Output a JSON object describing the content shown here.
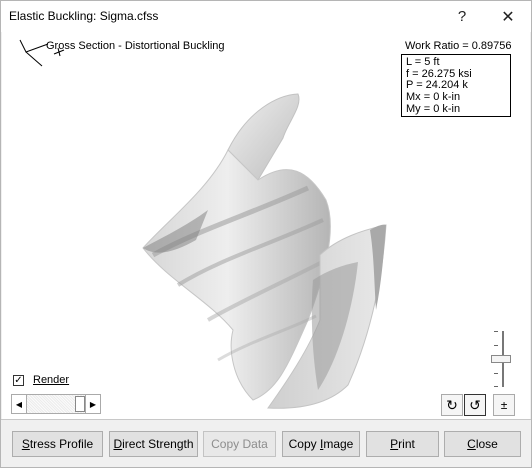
{
  "window": {
    "title": "Elastic Buckling: Sigma.cfss",
    "help_icon": "?",
    "close_icon": "✕"
  },
  "canvas": {
    "section_label": "Gross Section - Distortional Buckling",
    "work_ratio": "Work Ratio = 0.89756",
    "results": [
      "L = 5 ft",
      "f = 26.275 ksi",
      "P = 24.204 k",
      "Mx = 0 k-in",
      "My = 0 k-in"
    ]
  },
  "controls": {
    "render_label": "Render",
    "render_checked": true,
    "scroll_left_icon": "◀",
    "scroll_right_icon": "▶",
    "rotate_ccw_icon": "↻",
    "rotate_cw_icon": "↺",
    "plus_minus_label": "±"
  },
  "buttons": [
    {
      "label": "Stress Profile",
      "mnemonic": "S",
      "enabled": true
    },
    {
      "label": "Direct Strength",
      "mnemonic": "D",
      "enabled": true
    },
    {
      "label": "Copy Data",
      "mnemonic": "",
      "enabled": false
    },
    {
      "label": "Copy Image",
      "mnemonic": "I",
      "enabled": true
    },
    {
      "label": "Print",
      "mnemonic": "P",
      "enabled": true
    },
    {
      "label": "Close",
      "mnemonic": "C",
      "enabled": true
    }
  ]
}
